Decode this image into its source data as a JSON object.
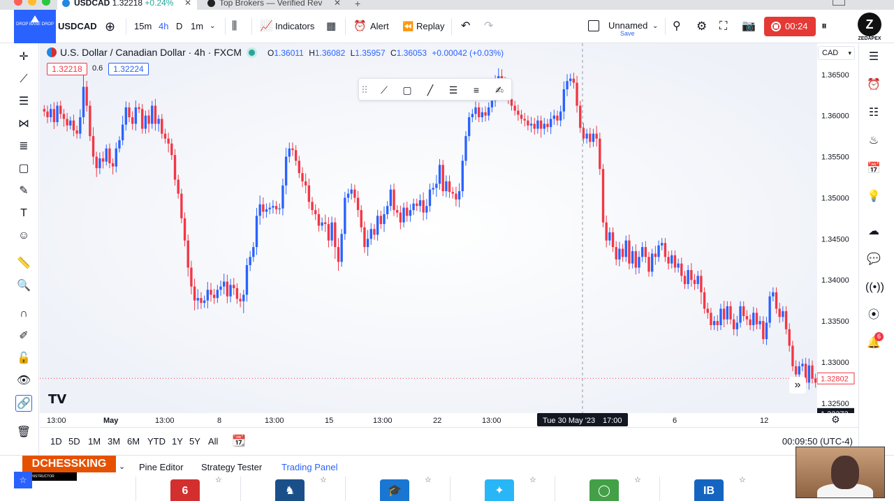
{
  "browser": {
    "tabs": [
      {
        "title": "USDCAD",
        "price": "1.32218",
        "change": "+0.24%"
      },
      {
        "title": "Top Brokers — Verified Rev"
      }
    ],
    "new_tab": "+"
  },
  "toolbar": {
    "logo_text": "DROP BASE DROP",
    "symbol": "USDCAD",
    "intervals": [
      "15m",
      "4h",
      "D",
      "1m"
    ],
    "active_interval": "4h",
    "indicators_label": "Indicators",
    "alert_label": "Alert",
    "replay_label": "Replay",
    "layout_name": "Unnamed",
    "layout_save": "Save",
    "record_time": "00:24",
    "brand_name": "ZEDAPEX"
  },
  "legend": {
    "title": "U.S. Dollar / Canadian Dollar · 4h · FXCM",
    "o_label": "O",
    "o": "1.36011",
    "h_label": "H",
    "h": "1.36082",
    "l_label": "L",
    "l": "1.35957",
    "c_label": "C",
    "c": "1.36053",
    "change": "+0.00042 (+0.03%)",
    "bid": "1.32218",
    "spread": "0.6",
    "ask": "1.32224"
  },
  "price_axis": {
    "currency": "CAD",
    "ticks": [
      "1.36500",
      "1.36000",
      "1.35500",
      "1.35000",
      "1.34500",
      "1.34000",
      "1.33500",
      "1.33000",
      "1.32500"
    ],
    "last_price": "1.32802",
    "cursor_price": "1.32373"
  },
  "time_axis": {
    "ticks": [
      "13:00",
      "May",
      "13:00",
      "8",
      "13:00",
      "15",
      "13:00",
      "22",
      "13:00",
      "6",
      "12"
    ],
    "cursor_label": "Tue 30 May '23",
    "cursor_time": "17:00"
  },
  "ranges": [
    "1D",
    "5D",
    "1M",
    "3M",
    "6M",
    "YTD",
    "1Y",
    "5Y",
    "All"
  ],
  "clock": "00:09:50 (UTC-4)",
  "bottom_panel": {
    "overlay_name": "DCHESSKING",
    "overlay_role": "INSTRUCTOR",
    "tabs": [
      "Pine Editor",
      "Strategy Tester",
      "Trading Panel"
    ],
    "active_tab": "Trading Panel",
    "brokers": [
      {
        "name": "broker-red",
        "glyph": "6",
        "color": "#d32f2f"
      },
      {
        "name": "broker-lion",
        "glyph": "♞",
        "color": "#1a4f8a"
      },
      {
        "name": "broker-cap",
        "glyph": "🎓",
        "color": "#1976d2"
      },
      {
        "name": "broker-star",
        "glyph": "✦",
        "color": "#29b6f6"
      },
      {
        "name": "broker-green",
        "glyph": "◯",
        "color": "#43a047"
      },
      {
        "name": "broker-ib",
        "glyph": "IB",
        "color": "#1565c0"
      }
    ]
  },
  "notifications_count": "6",
  "colors": {
    "up": "#2962ff",
    "down": "#f23645",
    "accent": "#2962ff",
    "record": "#e53935"
  },
  "chart_data": {
    "type": "candlestick",
    "title": "U.S. Dollar / Canadian Dollar · 4h · FXCM",
    "ylim": [
      1.3238,
      1.3688
    ],
    "close": [
      1.3605,
      1.3598,
      1.3608,
      1.3592,
      1.3612,
      1.3602,
      1.3596,
      1.3588,
      1.3594,
      1.3582,
      1.3578,
      1.3598,
      1.3635,
      1.3612,
      1.3575,
      1.355,
      1.3536,
      1.3548,
      1.3544,
      1.356,
      1.3542,
      1.3538,
      1.356,
      1.357,
      1.3589,
      1.361,
      1.3598,
      1.359,
      1.361,
      1.3608,
      1.3584,
      1.36,
      1.359,
      1.3612,
      1.359,
      1.3596,
      1.3578,
      1.3572,
      1.3566,
      1.3552,
      1.3522,
      1.3505,
      1.3475,
      1.3448,
      1.3415,
      1.3392,
      1.3375,
      1.3378,
      1.3372,
      1.3375,
      1.3388,
      1.3382,
      1.3378,
      1.3388,
      1.3392,
      1.3398,
      1.338,
      1.3394,
      1.339,
      1.3377,
      1.3374,
      1.3382,
      1.3418,
      1.3428,
      1.344,
      1.3478,
      1.3492,
      1.3483,
      1.3486,
      1.3488,
      1.349,
      1.3486,
      1.3487,
      1.3515,
      1.355,
      1.356,
      1.3558,
      1.3545,
      1.353,
      1.352,
      1.3515,
      1.3495,
      1.3485,
      1.348,
      1.3466,
      1.347,
      1.3468,
      1.3448,
      1.347,
      1.344,
      1.3422,
      1.3456,
      1.35,
      1.3505,
      1.351,
      1.35,
      1.3485,
      1.3464,
      1.344,
      1.345,
      1.3462,
      1.3455,
      1.3478,
      1.3468,
      1.348,
      1.349,
      1.351,
      1.3485,
      1.3482,
      1.347,
      1.3488,
      1.3478,
      1.3485,
      1.3493,
      1.349,
      1.3497,
      1.3482,
      1.349,
      1.351,
      1.3512,
      1.3517,
      1.354,
      1.3508,
      1.352,
      1.3507,
      1.3505,
      1.3498,
      1.3508,
      1.3545,
      1.3575,
      1.3598,
      1.3602,
      1.361,
      1.3598,
      1.3604,
      1.36,
      1.361,
      1.3618,
      1.3642,
      1.3648,
      1.364,
      1.3628,
      1.362,
      1.3612,
      1.3606,
      1.3601,
      1.3596,
      1.3594,
      1.3588,
      1.359,
      1.3584,
      1.3594,
      1.3584,
      1.359,
      1.3586,
      1.3596,
      1.36,
      1.3594,
      1.3605,
      1.3632,
      1.3642,
      1.3645,
      1.364,
      1.3612,
      1.3585,
      1.3572,
      1.3578,
      1.3568,
      1.3578,
      1.3572,
      1.3535,
      1.347,
      1.3448,
      1.3458,
      1.344,
      1.3425,
      1.3438,
      1.3428,
      1.3448,
      1.342,
      1.3435,
      1.3415,
      1.3428,
      1.344,
      1.3428,
      1.341,
      1.3432,
      1.3428,
      1.3442,
      1.3445,
      1.3428,
      1.342,
      1.343,
      1.3415,
      1.342,
      1.3405,
      1.3395,
      1.3412,
      1.34,
      1.3395,
      1.3405,
      1.3385,
      1.3365,
      1.336,
      1.3345,
      1.335,
      1.3345,
      1.3365,
      1.3352,
      1.3368,
      1.3352,
      1.334,
      1.3348,
      1.3368,
      1.3356,
      1.3352,
      1.3345,
      1.336,
      1.3346,
      1.335,
      1.3328,
      1.3348,
      1.338,
      1.3385,
      1.3365,
      1.3355,
      1.3362,
      1.334,
      1.332,
      1.3295,
      1.3285,
      1.3295,
      1.3298,
      1.3275,
      1.3296,
      1.328,
      1.3275
    ],
    "hi_pad": [
      4,
      6,
      5,
      7,
      4,
      5,
      5,
      6,
      4,
      6,
      5,
      8,
      12,
      6,
      5,
      9,
      5,
      6,
      7,
      4,
      5,
      5,
      6,
      4,
      9,
      6,
      5,
      6,
      7,
      4,
      5,
      5,
      6,
      5,
      7,
      4,
      5,
      5,
      6,
      5,
      6,
      5,
      5,
      6,
      6,
      7,
      8,
      9,
      6,
      5,
      8,
      7,
      6,
      5,
      6,
      8,
      7,
      6,
      7,
      5,
      6,
      5,
      7,
      6,
      5,
      8,
      9,
      7,
      6,
      5,
      6,
      5,
      5,
      7,
      9,
      6,
      6,
      5,
      5,
      6,
      8,
      7,
      5,
      6,
      6,
      5,
      8,
      7,
      6,
      5,
      9,
      5,
      6,
      5,
      6,
      5,
      7,
      5,
      6,
      9,
      6,
      5,
      6,
      5,
      8,
      5,
      5,
      6,
      5,
      7,
      5,
      6,
      6,
      5,
      5,
      6,
      8,
      7,
      6,
      5,
      9,
      6,
      5,
      6,
      6,
      5,
      7,
      8,
      6,
      5,
      5,
      5,
      6,
      5,
      5,
      6,
      5,
      5,
      6,
      8,
      7,
      6,
      5,
      5,
      5,
      6,
      5,
      6,
      5,
      7,
      6,
      5,
      5,
      6,
      5,
      7,
      6,
      5,
      6,
      8,
      7,
      5,
      6,
      7,
      5,
      5,
      5,
      6,
      5,
      8,
      6,
      5,
      7,
      5,
      5,
      6,
      7,
      5,
      5,
      6,
      5,
      7,
      6,
      5,
      6,
      5,
      5,
      8,
      5,
      5,
      5,
      6,
      5,
      5,
      5,
      6,
      5,
      5,
      7,
      6,
      5,
      6,
      5,
      6,
      5,
      5,
      6,
      5,
      8,
      5,
      5,
      6,
      7,
      5,
      5,
      6,
      5,
      6,
      5,
      5,
      5,
      6,
      5,
      5,
      5,
      6,
      5,
      5,
      6,
      5,
      6,
      5,
      5,
      6,
      7,
      5,
      5,
      5,
      6,
      5,
      5
    ],
    "lo_pad": [
      5,
      6,
      5,
      7,
      4,
      5,
      8,
      6,
      4,
      6,
      5,
      5,
      7,
      6,
      5,
      8,
      9,
      6,
      7,
      4,
      5,
      8,
      6,
      4,
      5,
      6,
      5,
      6,
      7,
      4,
      5,
      5,
      9,
      5,
      7,
      8,
      5,
      5,
      9,
      5,
      6,
      5,
      5,
      6,
      9,
      8,
      10,
      9,
      6,
      5,
      8,
      7,
      6,
      5,
      6,
      8,
      7,
      6,
      7,
      5,
      6,
      12,
      7,
      6,
      5,
      8,
      9,
      7,
      6,
      5,
      6,
      5,
      5,
      7,
      9,
      6,
      6,
      5,
      5,
      6,
      8,
      7,
      5,
      6,
      6,
      5,
      8,
      7,
      6,
      12,
      9,
      5,
      6,
      5,
      6,
      5,
      7,
      5,
      6,
      9,
      6,
      5,
      6,
      5,
      8,
      5,
      5,
      6,
      5,
      7,
      5,
      6,
      6,
      5,
      5,
      6,
      8,
      7,
      6,
      5,
      9,
      6,
      5,
      6,
      6,
      5,
      7,
      8,
      6,
      5,
      5,
      5,
      6,
      5,
      5,
      6,
      5,
      5,
      6,
      8,
      7,
      6,
      5,
      5,
      5,
      6,
      5,
      6,
      5,
      7,
      6,
      5,
      9,
      6,
      5,
      7,
      6,
      5,
      6,
      8,
      7,
      5,
      6,
      7,
      5,
      5,
      5,
      6,
      5,
      8,
      6,
      5,
      7,
      5,
      5,
      6,
      7,
      5,
      5,
      6,
      5,
      7,
      6,
      5,
      6,
      5,
      5,
      8,
      5,
      5,
      5,
      6,
      5,
      5,
      5,
      6,
      5,
      5,
      7,
      6,
      5,
      12,
      5,
      6,
      5,
      5,
      6,
      5,
      8,
      5,
      5,
      6,
      7,
      5,
      5,
      6,
      5,
      6,
      5,
      5,
      5,
      6,
      5,
      5,
      5,
      6,
      5,
      5,
      6,
      5,
      6,
      5,
      5,
      6,
      7,
      5,
      5,
      5,
      6,
      5,
      5
    ]
  }
}
